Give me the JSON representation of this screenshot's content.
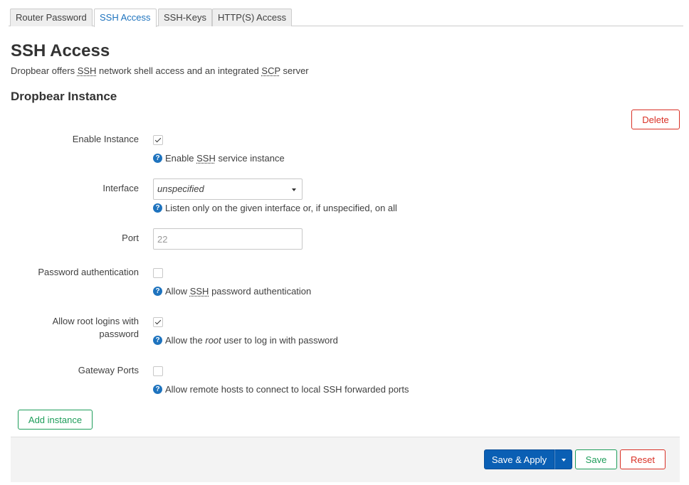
{
  "tabs": [
    {
      "label": "Router Password",
      "active": false
    },
    {
      "label": "SSH Access",
      "active": true
    },
    {
      "label": "SSH-Keys",
      "active": false
    },
    {
      "label": "HTTP(S) Access",
      "active": false
    }
  ],
  "page": {
    "title": "SSH Access",
    "desc_prefix": "Dropbear offers ",
    "desc_abbr1": "SSH",
    "desc_mid": " network shell access and an integrated ",
    "desc_abbr2": "SCP",
    "desc_suffix": " server"
  },
  "section": {
    "title": "Dropbear Instance",
    "delete_label": "Delete"
  },
  "fields": {
    "enable_instance": {
      "label": "Enable Instance",
      "checked": true,
      "help_prefix": "Enable ",
      "help_abbr": "SSH",
      "help_suffix": " service instance"
    },
    "interface": {
      "label": "Interface",
      "value": "unspecified",
      "help": "Listen only on the given interface or, if unspecified, on all"
    },
    "port": {
      "label": "Port",
      "placeholder": "22"
    },
    "password_auth": {
      "label": "Password authentication",
      "checked": false,
      "help_prefix": "Allow ",
      "help_abbr": "SSH",
      "help_suffix": " password authentication"
    },
    "root_login": {
      "label_line1": "Allow root logins with",
      "label_line2": "password",
      "checked": true,
      "help_prefix": "Allow the ",
      "help_em": "root",
      "help_suffix": " user to log in with password"
    },
    "gateway_ports": {
      "label": "Gateway Ports",
      "checked": false,
      "help": "Allow remote hosts to connect to local SSH forwarded ports"
    }
  },
  "add_instance_label": "Add instance",
  "footer": {
    "save_apply": "Save & Apply",
    "save": "Save",
    "reset": "Reset"
  },
  "icons": {
    "help": "help-icon",
    "help_glyph": "?"
  },
  "colors": {
    "accent_blue": "#1e73be",
    "primary_button": "#0a5fb4",
    "danger": "#d93025",
    "success": "#1e9d5a"
  }
}
